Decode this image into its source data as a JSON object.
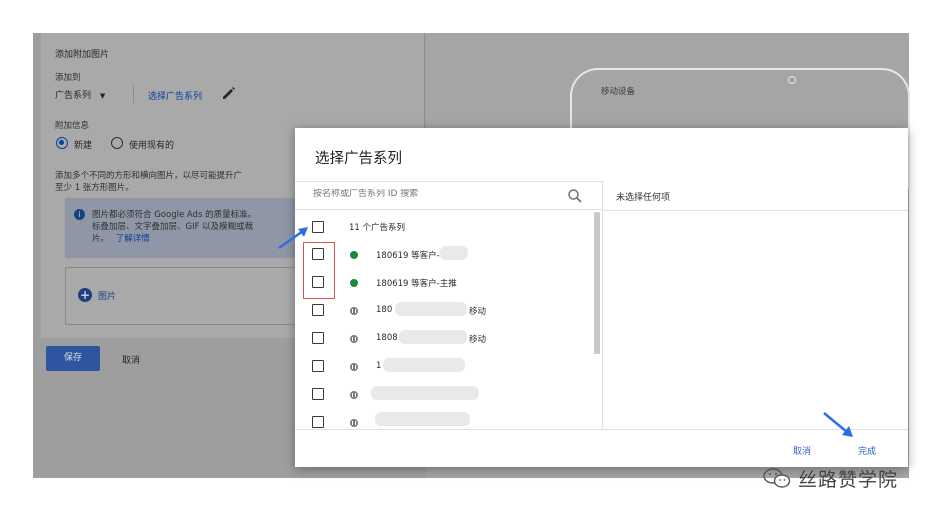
{
  "background_form": {
    "section_title": "添加附加图片",
    "add_to_label": "添加到",
    "add_to_value": "广告系列",
    "select_campaign_link": "选择广告系列",
    "extension_label": "附加信息",
    "radio_new": "新建",
    "radio_existing": "使用现有的",
    "hint_line1": "添加多个不同的方形和横向图片，以尽可能提升广",
    "hint_line2": "至少 1 张方形图片。",
    "info_line1": "图片都必须符合 Google Ads 的质量标准。",
    "info_line2": "标叠加层、文字叠加层、GIF 以及模糊或裁",
    "info_line3": "片。",
    "info_link": "了解详情",
    "add_image_label": "图片",
    "save_button": "保存",
    "cancel_button": "取消",
    "preview_label": "移动设备"
  },
  "dialog": {
    "title": "选择广告系列",
    "search_placeholder": "按名称或广告系列 ID 搜索",
    "right_pane_label": "未选择任何项",
    "select_all_label": "11 个广告系列",
    "campaigns": [
      {
        "label": "180619 等客户-",
        "status": "active"
      },
      {
        "label": "180619 等客户-主推",
        "status": "active"
      },
      {
        "label": "180",
        "suffix": "移动",
        "status": "paused"
      },
      {
        "label": "1808",
        "suffix": "移动",
        "status": "paused"
      },
      {
        "label": "1",
        "suffix": "",
        "status": "paused"
      },
      {
        "label": "",
        "suffix": "",
        "status": "paused"
      },
      {
        "label": "",
        "suffix": "",
        "status": "paused"
      }
    ],
    "cancel_button": "取消",
    "done_button": "完成"
  },
  "watermark": {
    "text": "丝路赞学院"
  },
  "colors": {
    "accent_blue": "#2f62c8",
    "active_green": "#1a8a3a",
    "arrow_blue": "#2b6fe0",
    "highlight_red": "#d9534f"
  }
}
